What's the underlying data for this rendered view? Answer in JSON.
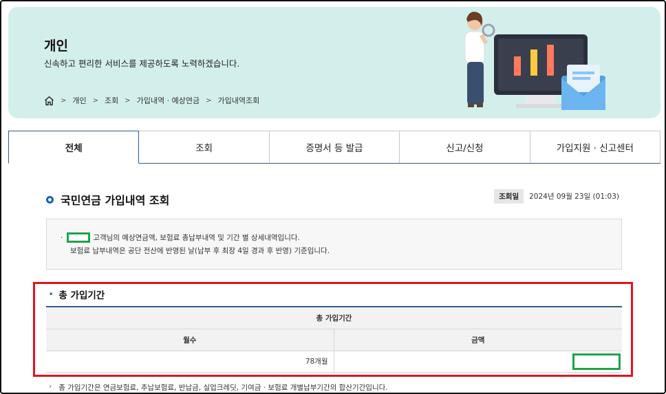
{
  "banner": {
    "title": "개인",
    "subtitle": "신속하고 편리한 서비스를 제공하도록 노력하겠습니다."
  },
  "breadcrumb": {
    "home_icon": "home-icon",
    "items": [
      "개인",
      "조회",
      "가입내역 · 예상연금",
      "가입내역조회"
    ]
  },
  "tabs": [
    "전체",
    "조회",
    "증명서 등 발급",
    "신고/신청",
    "가입지원 · 신고센터"
  ],
  "active_tab": "전체",
  "section": {
    "title": "국민연금 가입내역 조회",
    "query_date_label": "조회일",
    "query_date_value": "2024년 09월 23일 (01:03)"
  },
  "info": {
    "line1_suffix": "고객님의 예상연금액, 보험료 총납부내역 및 기간 별 상세내역입니다.",
    "line2": "보험료 납부내역은 공단 전산에 반영된 날(납부 후 최장 4일 경과 후 반영) 기준입니다."
  },
  "total_period": {
    "title": "총 가입기간",
    "table_header": "총 가입기간",
    "col_months": "월수",
    "col_amount": "금액",
    "months_value": "78개월",
    "amount_value": ""
  },
  "note": "총 가입기간은 연금보험료, 추납보험료, 반납금, 실업크레딧, 기여금 · 보험료 개별납부기간의 합산기간입니다.",
  "colors": {
    "banner_bg": "#d3efec",
    "accent_blue": "#1a5fb4",
    "tab_border": "#2d5c88",
    "highlight_red": "#e0141e",
    "mask_green": "#1ea44a"
  }
}
